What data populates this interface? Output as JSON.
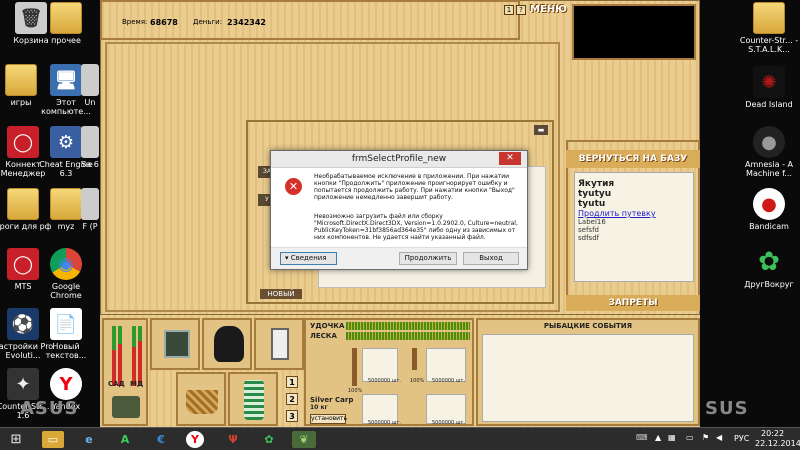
{
  "desktop_left": [
    {
      "label": "Корзина",
      "glyph": "🗑"
    },
    {
      "label": "прочее",
      "glyph": "📁"
    },
    {
      "label": "игры",
      "glyph": "📁"
    },
    {
      "label": "Этот компьюте...",
      "glyph": "🖥"
    },
    {
      "label": "Un",
      "glyph": ""
    },
    {
      "label": "Коннект Менеджер",
      "glyph": "◯"
    },
    {
      "label": "Cheat Engine 6.3",
      "glyph": "⚙"
    },
    {
      "label": "Sa 6",
      "glyph": ""
    },
    {
      "label": "проги для рф",
      "glyph": "📁"
    },
    {
      "label": "myz",
      "glyph": "📁"
    },
    {
      "label": "F (P",
      "glyph": ""
    },
    {
      "label": "MTS",
      "glyph": "◯"
    },
    {
      "label": "Google Chrome",
      "glyph": "◉"
    },
    {
      "label": "Настройки Pro Evoluti...",
      "glyph": "⚽"
    },
    {
      "label": "Новый текстов...",
      "glyph": "📄"
    },
    {
      "label": "Counter-Str... 1.6",
      "glyph": "✦"
    },
    {
      "label": "Yandex",
      "glyph": "Y"
    }
  ],
  "desktop_right": [
    {
      "label": "Counter-Str... - S.T.A.L.K...",
      "glyph": "📁"
    },
    {
      "label": "Dead Island",
      "glyph": "✺"
    },
    {
      "label": "Amnesia - A Machine f...",
      "glyph": "●"
    },
    {
      "label": "Bandicam",
      "glyph": "●"
    },
    {
      "label": "ДругВокруг",
      "glyph": "✿"
    }
  ],
  "game": {
    "time_label": "Время:",
    "time_value": "68678",
    "money_label": "Деньги:",
    "money_value": "2342342",
    "btn1": "1",
    "btn2": "?",
    "menu_title": "МЕНЮ",
    "right_title": "ВЕРНУТЬСЯ НА БАЗУ",
    "card": {
      "title1": "Якутия",
      "title2": "tyutyu",
      "title3": "tyutu",
      "link": "Продлить путевку",
      "l1": "Label16",
      "l2": "sefsfd",
      "l3": "sdfsdf"
    },
    "zapret": "ЗАПРЕТЫ",
    "inner_tab1": "ЗА",
    "inner_tab2": "У",
    "inner_close": "▬",
    "inner_new": "НОВЫЙ",
    "bottom": {
      "sad": "САД",
      "md": "МД",
      "udochka": "УДОЧКА",
      "leska": "ЛЕСКА",
      "fish_events": "РЫБАЦКИЕ СОБЫТИЯ",
      "n1": "1",
      "n2": "2",
      "n3": "3",
      "pct": "100%",
      "pct2": "100%",
      "qty1": "5000000 шт.",
      "qty2": "5000000 шт.",
      "qty3": "5000000 шт.",
      "qty4": "5000000 шт.",
      "fish_name": "Silver Carp",
      "fish_weight": "10 кг",
      "install": "установить"
    }
  },
  "error_dialog": {
    "title": "frmSelectProfile_new",
    "close": "✕",
    "message": "Необрабатываемое исключение в приложении. При нажатии\nкнопки \"Продолжить\" приложение проигнорирует ошибку и\nпопытается продолжить работу. При нажатии кнопки \"Выход\"\nприложение немедленно завершит работу.",
    "message2": "Невозможно загрузить файл или сборку\n\"Microsoft.DirectX.Direct3DX, Version=1.0.2902.0, Culture=neutral,\nPublicKeyToken=31bf3856ad364e35\" либо одну из зависимых от\nних компонентов. Не удается найти указанный файл.",
    "details": "▾ Сведения",
    "continue": "Продолжить",
    "exit": "Выход"
  },
  "taskbar": {
    "lang": "РУС",
    "time": "20:22",
    "date": "22.12.2014"
  },
  "colors": {
    "wood": "#e8c98a",
    "wood_border": "#a67c3c",
    "error_red": "#d5302a",
    "title_text": "#ffffff"
  }
}
